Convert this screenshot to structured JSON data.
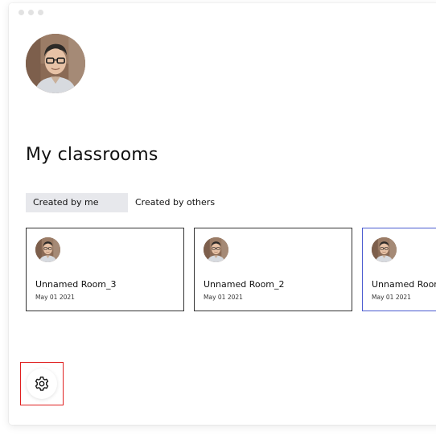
{
  "page": {
    "title": "My classrooms"
  },
  "profile": {
    "avatar_icon": "user-avatar-photo"
  },
  "tabs": [
    {
      "label": "Created by me",
      "active": true
    },
    {
      "label": "Created by others",
      "active": false
    }
  ],
  "rooms": [
    {
      "name": "Unnamed Room_3",
      "date": "May 01 2021",
      "selected": false
    },
    {
      "name": "Unnamed Room_2",
      "date": "May 01 2021",
      "selected": false
    },
    {
      "name": "Unnamed Room",
      "date": "May 01 2021",
      "selected": true
    }
  ],
  "settings": {
    "icon": "gear-icon",
    "highlight_color": "#e02020"
  },
  "colors": {
    "selected_card_border": "#4a5bd0",
    "active_tab_bg": "#e7e8ec"
  }
}
